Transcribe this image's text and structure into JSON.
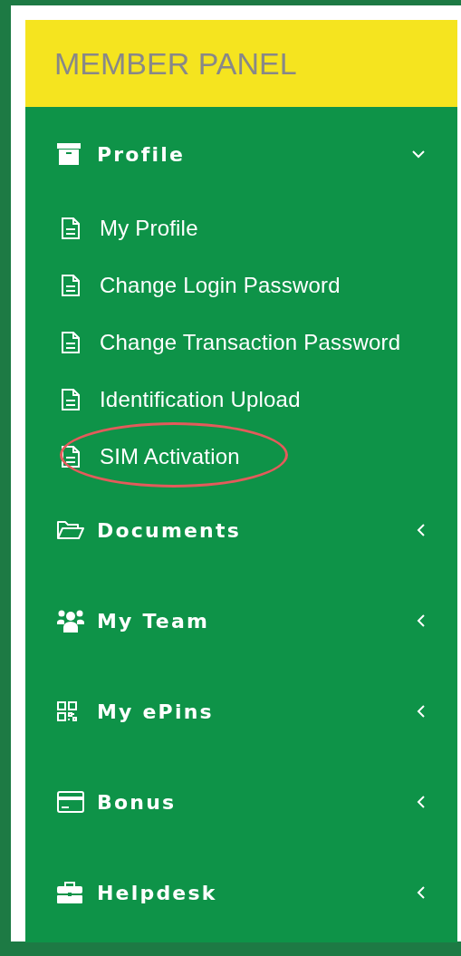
{
  "panel": {
    "title": "MEMBER PANEL"
  },
  "sections": [
    {
      "label": "Profile",
      "expanded": true,
      "children": [
        {
          "label": "My Profile",
          "highlighted": false
        },
        {
          "label": "Change Login Password",
          "highlighted": false
        },
        {
          "label": "Change Transaction Password",
          "highlighted": false
        },
        {
          "label": "Identification Upload",
          "highlighted": false
        },
        {
          "label": "SIM Activation",
          "highlighted": true
        }
      ]
    },
    {
      "label": "Documents",
      "expanded": false
    },
    {
      "label": "My Team",
      "expanded": false
    },
    {
      "label": "My ePins",
      "expanded": false
    },
    {
      "label": "Bonus",
      "expanded": false
    },
    {
      "label": "Helpdesk",
      "expanded": false
    }
  ]
}
